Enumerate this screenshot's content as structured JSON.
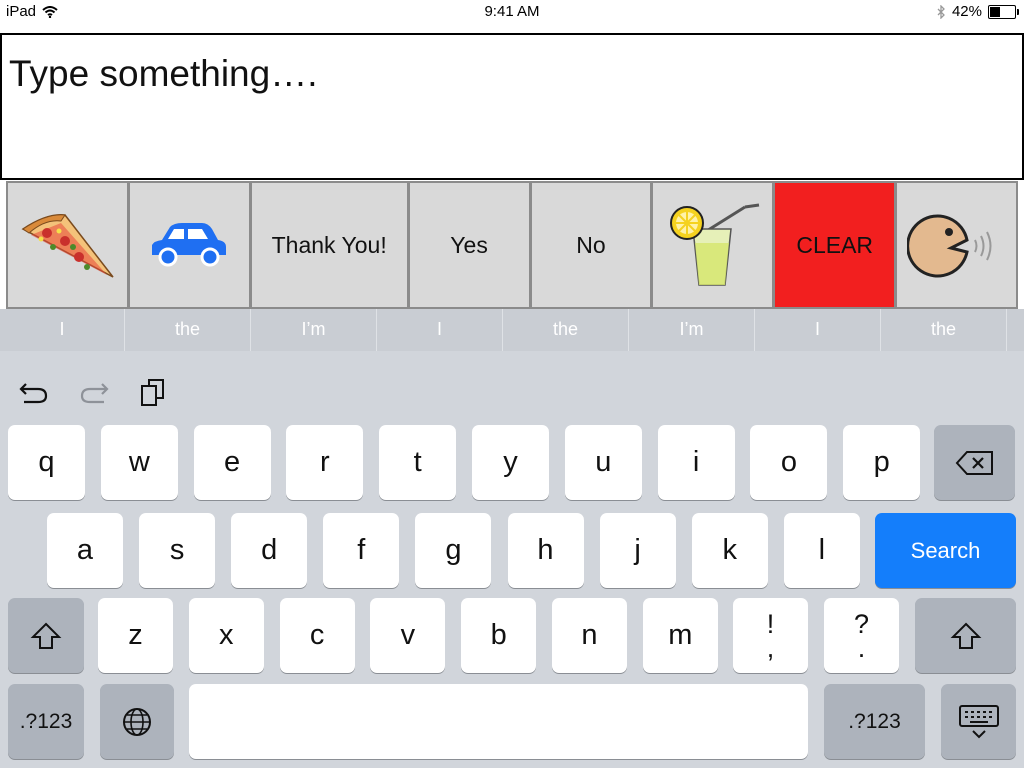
{
  "status": {
    "device": "iPad",
    "time": "9:41 AM",
    "battery_percent": "42%",
    "battery_level": 0.42
  },
  "textbox": {
    "placeholder": "Type something…."
  },
  "symbols": [
    {
      "kind": "pizza-icon",
      "label": ""
    },
    {
      "kind": "car-icon",
      "label": ""
    },
    {
      "kind": "text",
      "label": "Thank You!"
    },
    {
      "kind": "text",
      "label": "Yes"
    },
    {
      "kind": "text",
      "label": "No"
    },
    {
      "kind": "lemonade-icon",
      "label": ""
    },
    {
      "kind": "clear",
      "label": "CLEAR"
    },
    {
      "kind": "speak-icon",
      "label": ""
    }
  ],
  "suggestions": [
    "I",
    "the",
    "I’m",
    "I",
    "the",
    "I’m",
    "I",
    "the"
  ],
  "keys": {
    "row1": [
      "q",
      "w",
      "e",
      "r",
      "t",
      "y",
      "u",
      "i",
      "o",
      "p"
    ],
    "row2": [
      "a",
      "s",
      "d",
      "f",
      "g",
      "h",
      "j",
      "k",
      "l"
    ],
    "row3": [
      "z",
      "x",
      "c",
      "v",
      "b",
      "n",
      "m"
    ],
    "punct1": [
      "!",
      ","
    ],
    "punct2": [
      "?",
      "."
    ],
    "search": "Search",
    "numbers": ".?123"
  },
  "colors": {
    "clear": "#f21f1f",
    "accent": "#147efb",
    "car": "#1f6ff2"
  }
}
